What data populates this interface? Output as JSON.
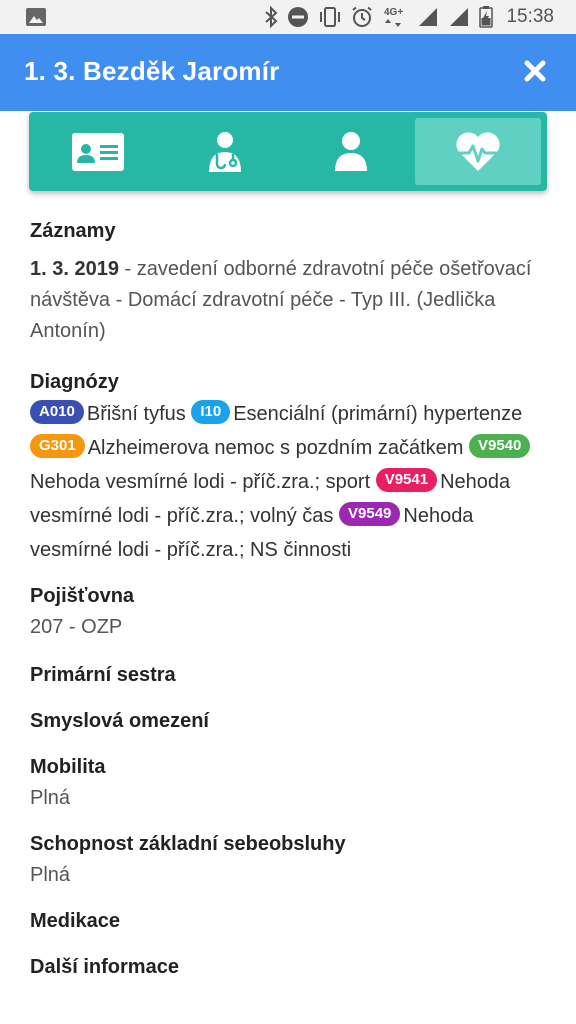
{
  "status_bar": {
    "time": "15:38",
    "network": "4G+",
    "icons": [
      "image-icon",
      "bluetooth-icon",
      "dnd-icon",
      "vibrate-icon",
      "alarm-icon",
      "network-icon",
      "signal-icon",
      "signal-icon",
      "battery-icon"
    ]
  },
  "header": {
    "title": "1. 3. Bezděk Jaromír",
    "close_icon": "close-icon"
  },
  "tabs": [
    {
      "icon": "id-card-icon",
      "active": false
    },
    {
      "icon": "doctor-icon",
      "active": false
    },
    {
      "icon": "person-icon",
      "active": false
    },
    {
      "icon": "heart-pulse-icon",
      "active": true
    }
  ],
  "records": {
    "title": "Záznamy",
    "date": "1. 3. 2019",
    "text": " - zavedení odborné zdravotní péče ošetřovací návštěva - Domácí zdravotní péče - Typ III. (Jedlička Antonín)"
  },
  "diagnoses": {
    "title": "Diagnózy",
    "items": [
      {
        "code": "A010",
        "label": "Břišní tyfus",
        "color": "#3a4fb4"
      },
      {
        "code": "I10",
        "label": "Esenciální (primární) hypertenze",
        "color": "#1aa3e8"
      },
      {
        "code": "G301",
        "label": "Alzheimerova nemoc s pozdním začátkem",
        "color": "#f5960f"
      },
      {
        "code": "V9540",
        "label": "Nehoda vesmírné lodi - příč.zra.; sport",
        "color": "#4caf50"
      },
      {
        "code": "V9541",
        "label": "Nehoda vesmírné lodi - příč.zra.; volný čas",
        "color": "#ea1e63"
      },
      {
        "code": "V9549",
        "label": "Nehoda vesmírné lodi - příč.zra.; NS činnosti",
        "color": "#9c27b0"
      }
    ]
  },
  "insurance": {
    "title": "Pojišťovna",
    "value": "207 - OZP"
  },
  "primary_nurse": {
    "title": "Primární sestra"
  },
  "sensory": {
    "title": "Smyslová omezení"
  },
  "mobility": {
    "title": "Mobilita",
    "value": "Plná"
  },
  "self_care": {
    "title": "Schopnost základní sebeobsluhy",
    "value": "Plná"
  },
  "medication": {
    "title": "Medikace"
  },
  "more_info": {
    "title": "Další informace"
  }
}
